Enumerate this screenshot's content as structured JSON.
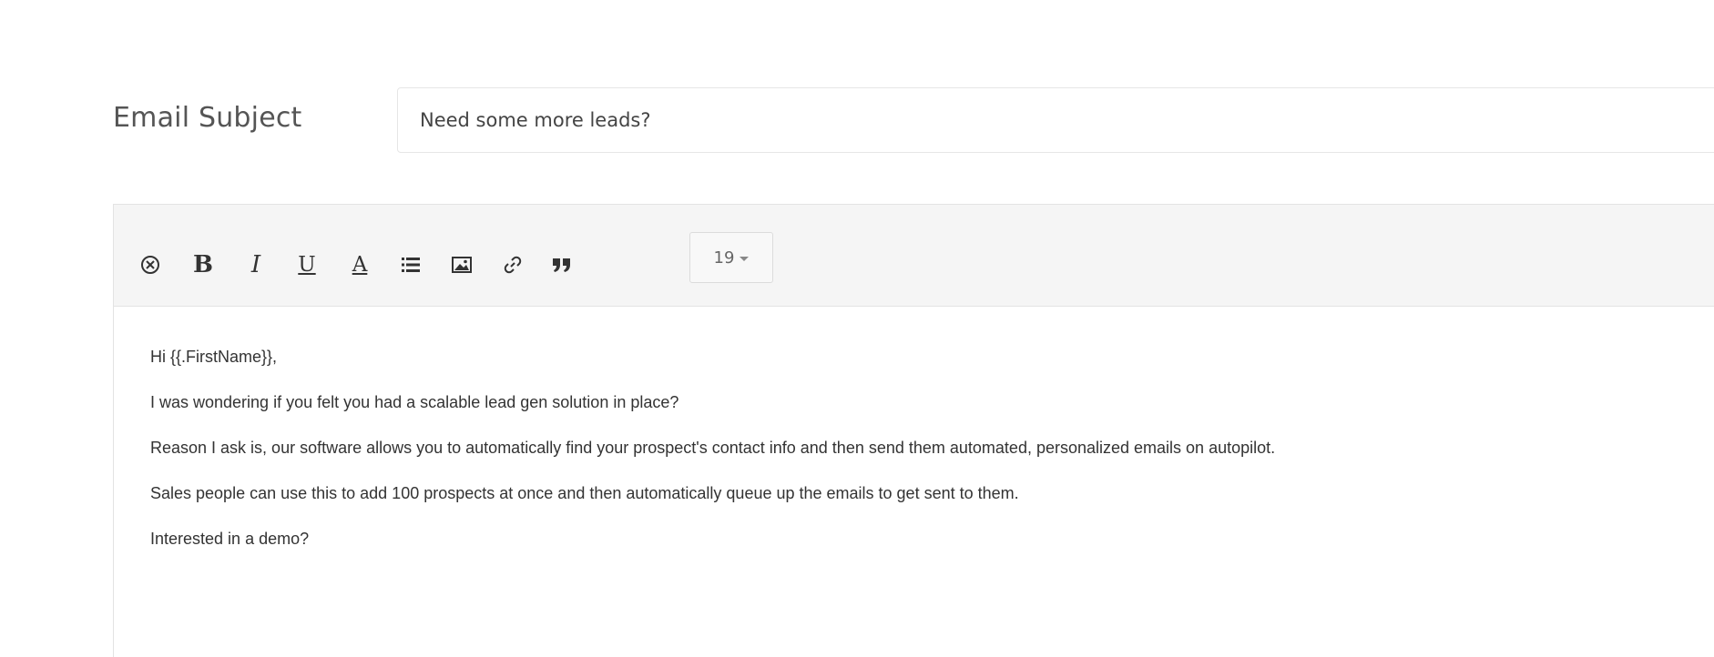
{
  "subject": {
    "label": "Email Subject",
    "value": "Need some more leads?"
  },
  "toolbar": {
    "buttons": [
      {
        "name": "clear-format-icon",
        "glyph": "⊗"
      },
      {
        "name": "bold-button",
        "glyph": "B"
      },
      {
        "name": "italic-button",
        "glyph": "I"
      },
      {
        "name": "underline-button",
        "glyph": "U"
      },
      {
        "name": "font-color-button",
        "glyph": "A"
      },
      {
        "name": "list-button",
        "glyph": "list-icon"
      },
      {
        "name": "image-button",
        "glyph": "image-icon"
      },
      {
        "name": "link-button",
        "glyph": "link-icon"
      },
      {
        "name": "blockquote-button",
        "glyph": "quote-icon"
      }
    ],
    "font_size": "19"
  },
  "body": {
    "lines": [
      "Hi {{.FirstName}},",
      "I was wondering if you felt you had a scalable lead gen solution in place?",
      "Reason I ask is, our software allows you to automatically find your prospect's contact info and then send them automated, personalized emails on autopilot.",
      "Sales people can use this to add 100 prospects at once and then automatically queue up the emails to get sent to them.",
      "Interested in a demo?"
    ]
  }
}
